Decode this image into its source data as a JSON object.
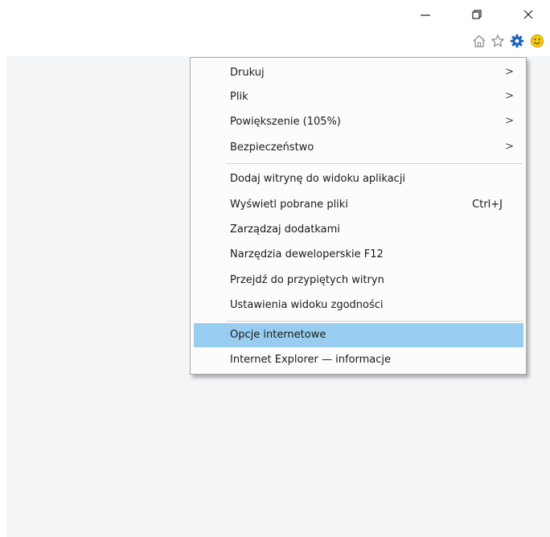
{
  "window": {
    "minimize_icon": "minimize-icon",
    "restore_icon": "restore-icon",
    "close_icon": "close-icon"
  },
  "toolbar": {
    "home_icon": "home-icon",
    "favorites_icon": "star-icon",
    "tools_icon": "gear-icon",
    "feedback_icon": "smiley-icon"
  },
  "tools_menu": {
    "items": [
      {
        "label": "Drukuj",
        "submenu": true
      },
      {
        "label": "Plik",
        "submenu": true
      },
      {
        "label": "Powiększenie (105%)",
        "submenu": true
      },
      {
        "label": "Bezpieczeństwo",
        "submenu": true
      },
      {
        "label": "Dodaj witrynę do widoku aplikacji"
      },
      {
        "label": "Wyświetl pobrane pliki",
        "shortcut": "Ctrl+J"
      },
      {
        "label": "Zarządzaj dodatkami"
      },
      {
        "label": "Narzędzia deweloperskie F12"
      },
      {
        "label": "Przejdź do przypiętych witryn"
      },
      {
        "label": "Ustawienia widoku zgodności"
      },
      {
        "label": "Opcje internetowe",
        "highlighted": true
      },
      {
        "label": "Internet Explorer — informacje"
      }
    ],
    "submenu_arrow": ">"
  },
  "colors": {
    "highlight": "#98cdf0",
    "content_background": "#f4f5f7",
    "gear_blue": "#1e63b8",
    "smiley_yellow": "#f2c818"
  }
}
